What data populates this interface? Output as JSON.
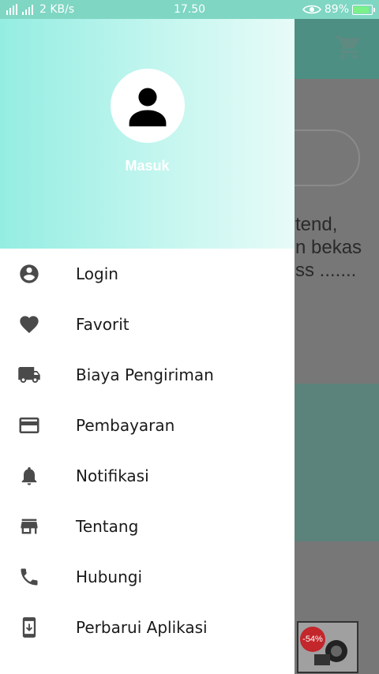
{
  "status_bar": {
    "network": "2 KB/s",
    "time": "17.50",
    "battery": "89%",
    "battery_fraction": 0.89
  },
  "background": {
    "text_lines": [
      "tend,",
      "n bekas",
      "ss ......."
    ],
    "discount_badge": "-54%"
  },
  "drawer": {
    "header_label": "Masuk",
    "items": [
      {
        "label": "Login",
        "icon": "account-circle-icon"
      },
      {
        "label": "Favorit",
        "icon": "heart-icon"
      },
      {
        "label": "Biaya Pengiriman",
        "icon": "truck-icon"
      },
      {
        "label": "Pembayaran",
        "icon": "credit-card-icon"
      },
      {
        "label": "Notifikasi",
        "icon": "bell-icon"
      },
      {
        "label": "Tentang",
        "icon": "store-icon"
      },
      {
        "label": "Hubungi",
        "icon": "phone-icon"
      },
      {
        "label": "Perbarui Aplikasi",
        "icon": "app-update-icon"
      }
    ]
  },
  "colors": {
    "accent": "#4d8f83",
    "header_gradient_start": "#94ede2",
    "icon": "#4a4a4a"
  }
}
